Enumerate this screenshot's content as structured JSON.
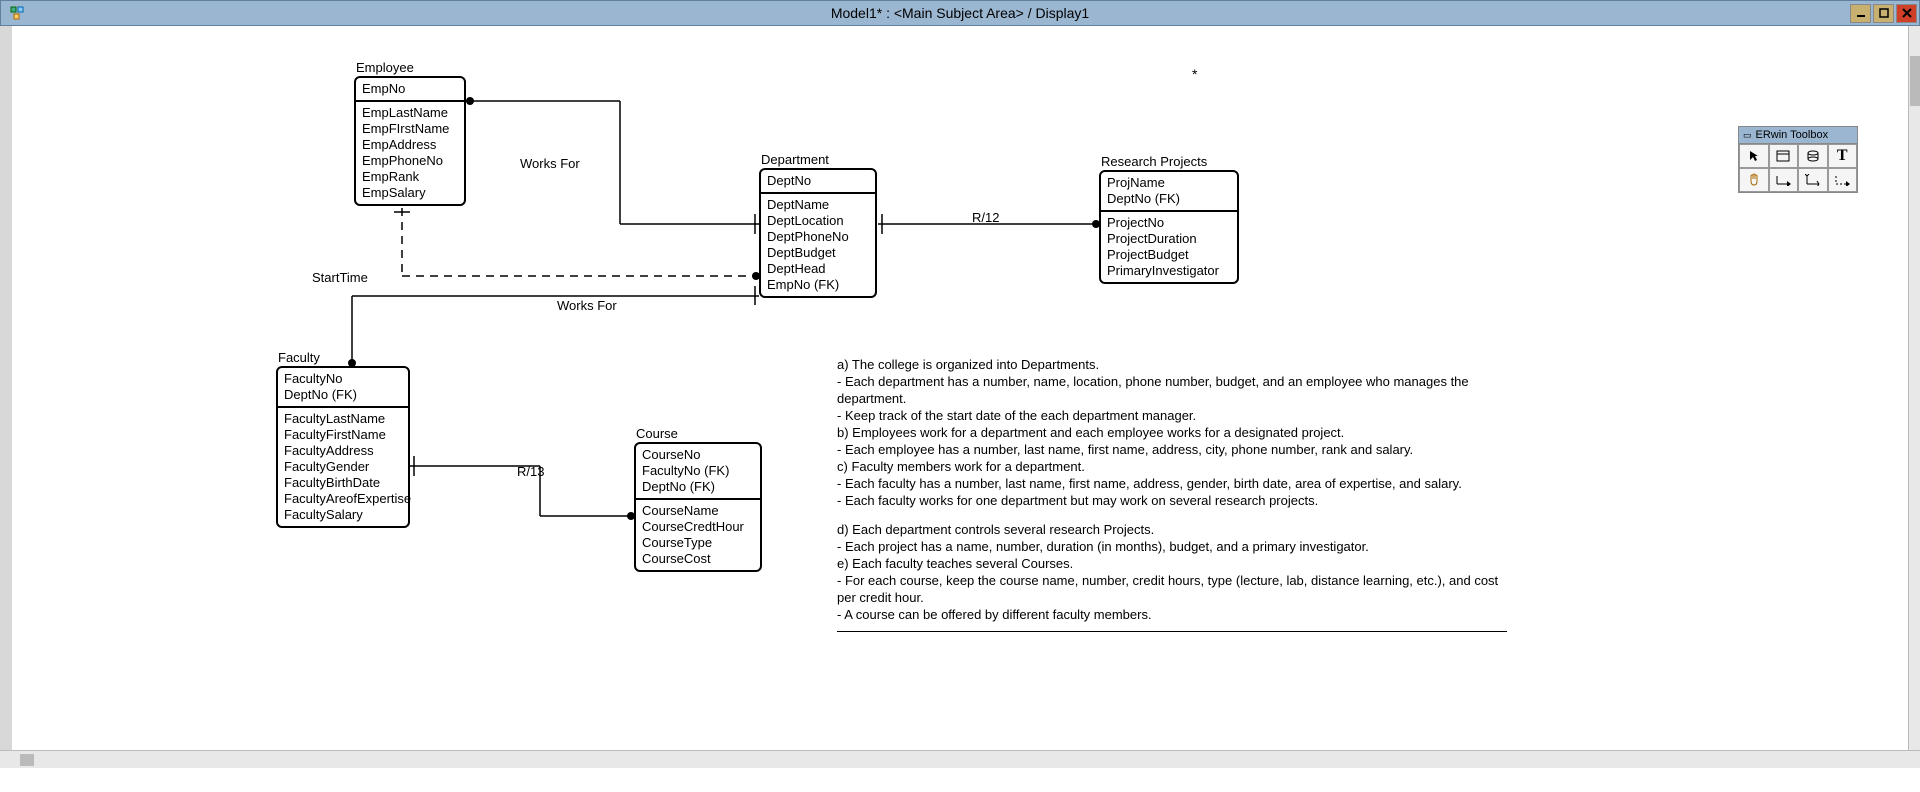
{
  "window": {
    "title": "Model1* : <Main Subject Area> / Display1"
  },
  "toolbox": {
    "title": "ERwin Toolbox"
  },
  "entities": {
    "employee": {
      "name": "Employee",
      "pk": [
        "EmpNo"
      ],
      "attrs": [
        "EmpLastName",
        "EmpFIrstName",
        "EmpAddress",
        "EmpPhoneNo",
        "EmpRank",
        "EmpSalary"
      ]
    },
    "department": {
      "name": "Department",
      "pk": [
        "DeptNo"
      ],
      "attrs": [
        "DeptName",
        "DeptLocation",
        "DeptPhoneNo",
        "DeptBudget",
        "DeptHead",
        "EmpNo (FK)"
      ]
    },
    "research": {
      "name": "Research Projects",
      "pk": [
        "ProjName",
        "DeptNo (FK)"
      ],
      "attrs": [
        "ProjectNo",
        "ProjectDuration",
        "ProjectBudget",
        "PrimaryInvestigator"
      ]
    },
    "faculty": {
      "name": "Faculty",
      "pk": [
        "FacultyNo",
        "DeptNo (FK)"
      ],
      "attrs": [
        "FacultyLastName",
        "FacultyFirstName",
        "FacultyAddress",
        "FacultyGender",
        "FacultyBirthDate",
        "FacultyAreofExpertise",
        "FacultySalary"
      ]
    },
    "course": {
      "name": "Course",
      "pk": [
        "CourseNo",
        "FacultyNo (FK)",
        "DeptNo (FK)"
      ],
      "attrs": [
        "CourseName",
        "CourseCredtHour",
        "CourseType",
        "CourseCost"
      ]
    }
  },
  "relationships": {
    "worksFor1": "Works For",
    "worksFor2": "Works For",
    "startTime": "StartTime",
    "r12": "R/12",
    "r13": "R/13"
  },
  "description": {
    "a_title": "a) The college is organized into Departments.",
    "a_1": "- Each department has a number, name, location, phone number, budget, and an employee who manages the department.",
    "a_2": "- Keep track of the start date of the each department manager.",
    "b_title": "b) Employees work for a department and each employee works for a designated project.",
    "b_1": "- Each employee has a number, last name, first name, address, city, phone number, rank and salary.",
    "c_title": "c) Faculty members work for a department.",
    "c_1": "- Each faculty has a number, last name, first name, address, gender, birth date, area of expertise, and salary.",
    "c_2": "- Each faculty works for one department but may work on several research projects.",
    "d_title": "d) Each department controls several research Projects.",
    "d_1": "- Each project has a name, number, duration (in months), budget, and a primary investigator.",
    "e_title": "e) Each faculty teaches several Courses.",
    "e_1": "- For each course, keep the course name, number, credit hours, type (lecture, lab, distance learning, etc.), and cost per credit hour.",
    "e_2": "- A course can be offered by different faculty members."
  },
  "star": "*"
}
